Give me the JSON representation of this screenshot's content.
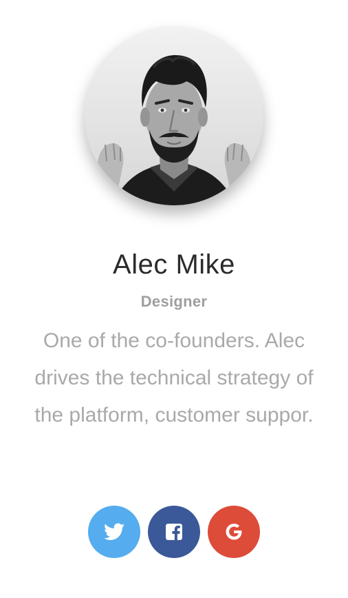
{
  "profile": {
    "name": "Alec Mike",
    "role": "Designer",
    "bio": "One of the co-founders. Alec drives the technical strategy of the platform, customer suppor."
  },
  "social": [
    {
      "network": "twitter",
      "icon": "twitter-icon",
      "color": "#55acee"
    },
    {
      "network": "facebook",
      "icon": "facebook-icon",
      "color": "#3b5998"
    },
    {
      "network": "google",
      "icon": "google-plus-icon",
      "color": "#dd4b39"
    }
  ],
  "colors": {
    "name": "#2b2b2b",
    "role": "#9e9e9e",
    "bio": "#a9a9a9"
  }
}
